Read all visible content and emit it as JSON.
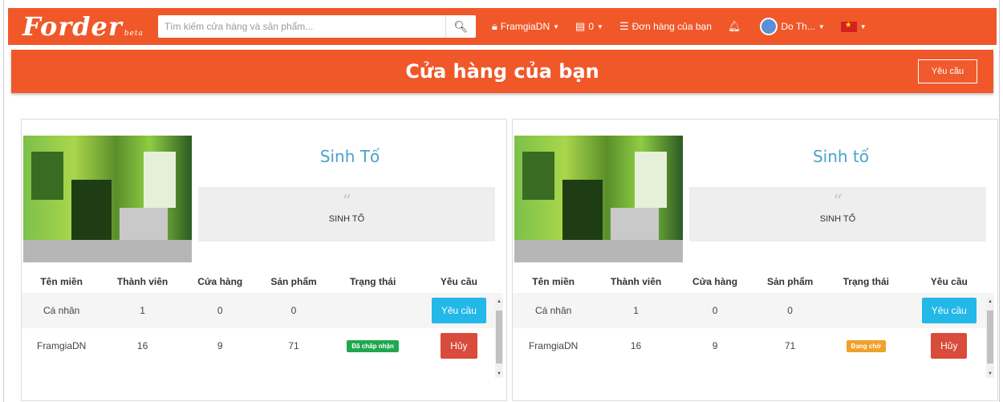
{
  "brand": {
    "logo_text": "Forder",
    "beta": "beta"
  },
  "search": {
    "placeholder": "Tìm kiếm cửa hàng và sản phẩm...",
    "icon": "search-icon"
  },
  "nav": {
    "shop_label": "FramgiaDN",
    "cart_count": "0",
    "orders_label": "Đơn hàng của bạn",
    "user_label": "Do Th...",
    "colors": {
      "accent": "#f0582a"
    }
  },
  "page": {
    "title": "Cửa hàng của bạn",
    "request_button": "Yêu cầu"
  },
  "table_headers": [
    "Tên miền",
    "Thành viên",
    "Cửa hàng",
    "Sản phẩm",
    "Trạng thái",
    "Yêu cầu"
  ],
  "cards": [
    {
      "name": "Sinh Tố",
      "quote": "SINH TỐ",
      "rows": [
        {
          "domain": "Cá nhân",
          "members": "1",
          "shops": "0",
          "products": "0",
          "status": "",
          "action": "Yêu cầu"
        },
        {
          "domain": "FramgiaDN",
          "members": "16",
          "shops": "9",
          "products": "71",
          "status": "Đã chấp nhận",
          "action": "Hủy"
        }
      ]
    },
    {
      "name": "Sinh tố",
      "quote": "SINH TỐ",
      "rows": [
        {
          "domain": "Cá nhân",
          "members": "1",
          "shops": "0",
          "products": "0",
          "status": "",
          "action": "Yêu cầu"
        },
        {
          "domain": "FramgiaDN",
          "members": "16",
          "shops": "9",
          "products": "71",
          "status": "Đang chờ",
          "action": "Hủy"
        }
      ]
    }
  ]
}
